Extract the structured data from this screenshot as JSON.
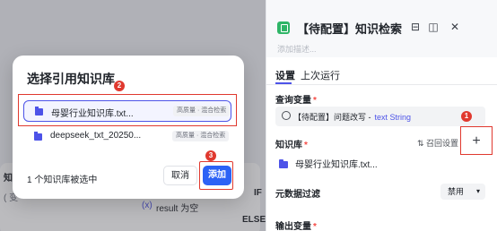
{
  "canvas": {
    "frag_left": "知",
    "frag_bottom": "( 变",
    "frag_var": "(x)",
    "frag_result": "result 为空",
    "frag_if": "IF",
    "frag_else": "ELSE"
  },
  "panel": {
    "title": "【待配置】知识检索",
    "description": "添加描述...",
    "tabs": [
      "设置",
      "上次运行"
    ],
    "query_label": "查询变量",
    "query_value": "【待配置】问题改写 -",
    "query_type": "text String",
    "kb_label": "知识库",
    "recall_label": "召回设置",
    "kb_items": [
      "母婴行业知识库.txt..."
    ],
    "metadata_label": "元数据过滤",
    "metadata_value": "禁用",
    "output_label": "输出变量",
    "required_mark": "*"
  },
  "dialog": {
    "title": "选择引用知识库",
    "rows": [
      {
        "name": "母婴行业知识库.txt...",
        "tag": "高质量 · 混合检索",
        "selected": true
      },
      {
        "name": "deepseek_txt_20250...",
        "tag": "高质量 · 混合检索",
        "selected": false
      }
    ],
    "selected_count": "1 个知识库被选中",
    "cancel_label": "取消",
    "add_label": "添加"
  },
  "steps": [
    "1",
    "2",
    "3"
  ],
  "colors": {
    "accent": "#4d53e8",
    "primary_button": "#2c62f6",
    "highlight": "#e0392f",
    "node_green": "#2fb567"
  },
  "icons": [
    "play-icon",
    "dock-icon",
    "book-icon",
    "close-icon",
    "folder-icon",
    "plus-icon",
    "recall-settings-icon",
    "chevron-down-icon"
  ]
}
